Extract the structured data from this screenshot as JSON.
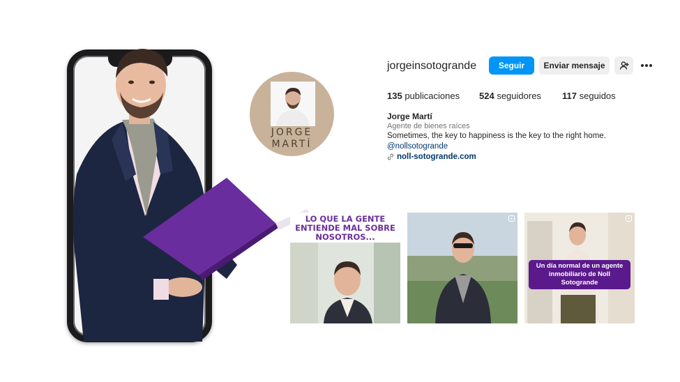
{
  "profile": {
    "username": "jorgeinsotogrande",
    "follow_label": "Seguir",
    "message_label": "Enviar mensaje",
    "add_user_icon": "add-user-icon",
    "more_icon": "more-options-icon",
    "avatar_text_line1": "JORGE",
    "avatar_text_line2": "MARTÍ",
    "stats": {
      "posts_count": "135",
      "posts_label": "publicaciones",
      "followers_count": "524",
      "followers_label": "seguidores",
      "following_count": "117",
      "following_label": "seguidos"
    },
    "bio": {
      "name": "Jorge Martí",
      "category": "Agente de bienes raíces",
      "text": "Sometimes, the key to happiness is the key to the right home.",
      "mention": "@nollsotogrande",
      "link": "noll-sotogrande.com"
    }
  },
  "posts": [
    {
      "title": "LO QUE LA GENTE ENTIENDE MAL SOBRE NOSOTROS..."
    },
    {
      "reel": true
    },
    {
      "reel": true,
      "caption": "Un día normal de un agente inmobiliario de Noll Sotogrande"
    }
  ],
  "colors": {
    "follow_button": "#0095f6",
    "brand_purple": "#5b1a8c",
    "avatar_ring": "#c8b39a",
    "link": "#00376b"
  }
}
